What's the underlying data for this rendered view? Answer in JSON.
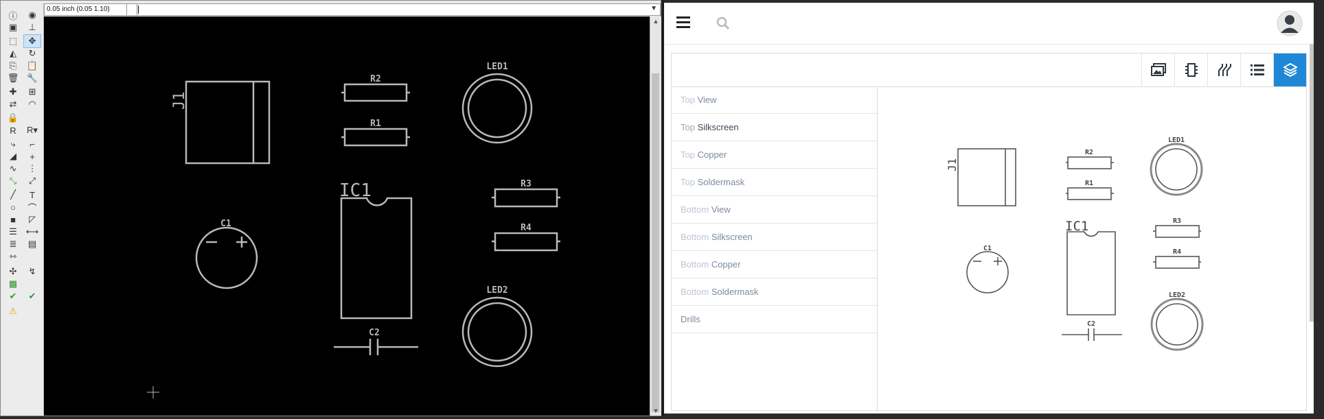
{
  "kicad": {
    "grid": {
      "label": "0.05 inch (0.05 1.10)"
    },
    "toolbar": [
      {
        "name": "info-icon",
        "glyph": "ⓘ",
        "pos": [
          0,
          0
        ]
      },
      {
        "name": "eye-icon",
        "glyph": "◉",
        "pos": [
          1,
          0
        ]
      },
      {
        "name": "layers-color-icon",
        "glyph": "▣",
        "pos": [
          0,
          1
        ]
      },
      {
        "name": "pin-add-icon",
        "glyph": "⊥",
        "pos": [
          1,
          1
        ]
      },
      {
        "name": "select-tool-icon",
        "glyph": "⬚",
        "pos": [
          0,
          2
        ]
      },
      {
        "name": "move-tool-icon",
        "glyph": "✥",
        "pos": [
          1,
          2
        ],
        "selected": true
      },
      {
        "name": "mirror-icon",
        "glyph": "◭",
        "pos": [
          0,
          3
        ]
      },
      {
        "name": "rotate-icon",
        "glyph": "↻",
        "pos": [
          1,
          3
        ]
      },
      {
        "name": "copy-icon",
        "glyph": "⎘",
        "pos": [
          0,
          4
        ]
      },
      {
        "name": "paste-icon",
        "glyph": "📋",
        "pos": [
          1,
          4
        ]
      },
      {
        "name": "delete-icon",
        "glyph": "🗑",
        "pos": [
          0,
          5
        ]
      },
      {
        "name": "wrench-icon",
        "glyph": "🔧",
        "pos": [
          1,
          5
        ]
      },
      {
        "name": "add-part-icon",
        "glyph": "✚",
        "pos": [
          0,
          6
        ]
      },
      {
        "name": "group-icon",
        "glyph": "⊞",
        "pos": [
          1,
          6
        ]
      },
      {
        "name": "swap-icon",
        "glyph": "⇄",
        "pos": [
          0,
          7
        ]
      },
      {
        "name": "arc-icon",
        "glyph": "◠",
        "pos": [
          1,
          7
        ]
      },
      {
        "name": "lock-icon",
        "glyph": "🔒",
        "pos": [
          0,
          8
        ]
      },
      {
        "name": "r2-10k-label-icon",
        "glyph": "R",
        "pos": [
          0,
          9
        ]
      },
      {
        "name": "r2-10k-dropdown-icon",
        "glyph": "R▾",
        "pos": [
          1,
          9
        ]
      },
      {
        "name": "route-icon",
        "glyph": "⤷",
        "pos": [
          0,
          10
        ]
      },
      {
        "name": "miter-icon",
        "glyph": "⌐",
        "pos": [
          1,
          10
        ]
      },
      {
        "name": "ramp-icon",
        "glyph": "◢",
        "pos": [
          0,
          11
        ]
      },
      {
        "name": "junction-icon",
        "glyph": "+",
        "pos": [
          1,
          11
        ]
      },
      {
        "name": "meander-icon",
        "glyph": "∿",
        "pos": [
          0,
          12
        ]
      },
      {
        "name": "diff-pair-icon",
        "glyph": "⋮",
        "pos": [
          1,
          12
        ]
      },
      {
        "name": "track-green-icon",
        "glyph": "⤡",
        "pos": [
          0,
          13
        ]
      },
      {
        "name": "track-branch-icon",
        "glyph": "⤢",
        "pos": [
          1,
          13
        ]
      },
      {
        "name": "line-tool-icon",
        "glyph": "╱",
        "pos": [
          0,
          14
        ]
      },
      {
        "name": "text-tool-icon",
        "glyph": "T",
        "pos": [
          1,
          14
        ]
      },
      {
        "name": "circle-tool-icon",
        "glyph": "○",
        "pos": [
          0,
          15
        ]
      },
      {
        "name": "arc-tool-icon",
        "glyph": "⌒",
        "pos": [
          1,
          15
        ]
      },
      {
        "name": "rect-fill-icon",
        "glyph": "■",
        "pos": [
          0,
          16
        ]
      },
      {
        "name": "polygon-icon",
        "glyph": "◸",
        "pos": [
          1,
          16
        ]
      },
      {
        "name": "zone-icon",
        "glyph": "☰",
        "pos": [
          0,
          17
        ]
      },
      {
        "name": "connect-icon",
        "glyph": "⟷",
        "pos": [
          1,
          17
        ]
      },
      {
        "name": "stack-icon",
        "glyph": "≣",
        "pos": [
          0,
          18
        ]
      },
      {
        "name": "attr-icon",
        "glyph": "▤",
        "pos": [
          1,
          18
        ]
      },
      {
        "name": "measure-icon",
        "glyph": "⇿",
        "pos": [
          0,
          19
        ]
      },
      {
        "name": "netlist-icon",
        "glyph": "✣",
        "pos": [
          0,
          20
        ]
      },
      {
        "name": "autoroute-icon",
        "glyph": "↯",
        "pos": [
          1,
          20
        ]
      },
      {
        "name": "board-icon",
        "glyph": "▩",
        "pos": [
          0,
          21
        ]
      },
      {
        "name": "erc-check-icon",
        "glyph": "✔",
        "pos": [
          0,
          22
        ]
      },
      {
        "name": "drc-check-icon",
        "glyph": "✔",
        "pos": [
          1,
          22
        ]
      },
      {
        "name": "warning-icon",
        "glyph": "⚠",
        "pos": [
          0,
          23
        ]
      }
    ],
    "labels": {
      "j1": "J1",
      "r2": "R2",
      "r1": "R1",
      "led1": "LED1",
      "ic1": "IC1",
      "r3": "R3",
      "r4": "R4",
      "c1": "C1",
      "led2": "LED2",
      "c2": "C2"
    }
  },
  "viewer": {
    "search_placeholder": "",
    "panel_tabs": [
      {
        "name": "tab-render-images",
        "icon": "images-icon"
      },
      {
        "name": "tab-components",
        "icon": "chip-icon"
      },
      {
        "name": "tab-nets",
        "icon": "traces-icon"
      },
      {
        "name": "tab-bom",
        "icon": "list-icon"
      },
      {
        "name": "tab-layers",
        "icon": "layers-icon",
        "active": true
      }
    ],
    "layers": [
      {
        "prefix": "Top",
        "label": "View"
      },
      {
        "prefix": "Top",
        "label": "Silkscreen",
        "selected": true
      },
      {
        "prefix": "Top",
        "label": "Copper"
      },
      {
        "prefix": "Top",
        "label": "Soldermask"
      },
      {
        "prefix": "Bottom",
        "label": "View"
      },
      {
        "prefix": "Bottom",
        "label": "Silkscreen"
      },
      {
        "prefix": "Bottom",
        "label": "Copper"
      },
      {
        "prefix": "Bottom",
        "label": "Soldermask"
      },
      {
        "prefix": "",
        "label": "Drills"
      }
    ],
    "preview_labels": {
      "j1": "J1",
      "r2": "R2",
      "r1": "R1",
      "led1": "LED1",
      "ic1": "IC1",
      "r3": "R3",
      "r4": "R4",
      "c1": "C1",
      "led2": "LED2",
      "c2": "C2"
    },
    "colors": {
      "accent": "#1e88d6",
      "silkscreen_dark": "#b9b9b9",
      "silkscreen_light": "#555555"
    }
  }
}
